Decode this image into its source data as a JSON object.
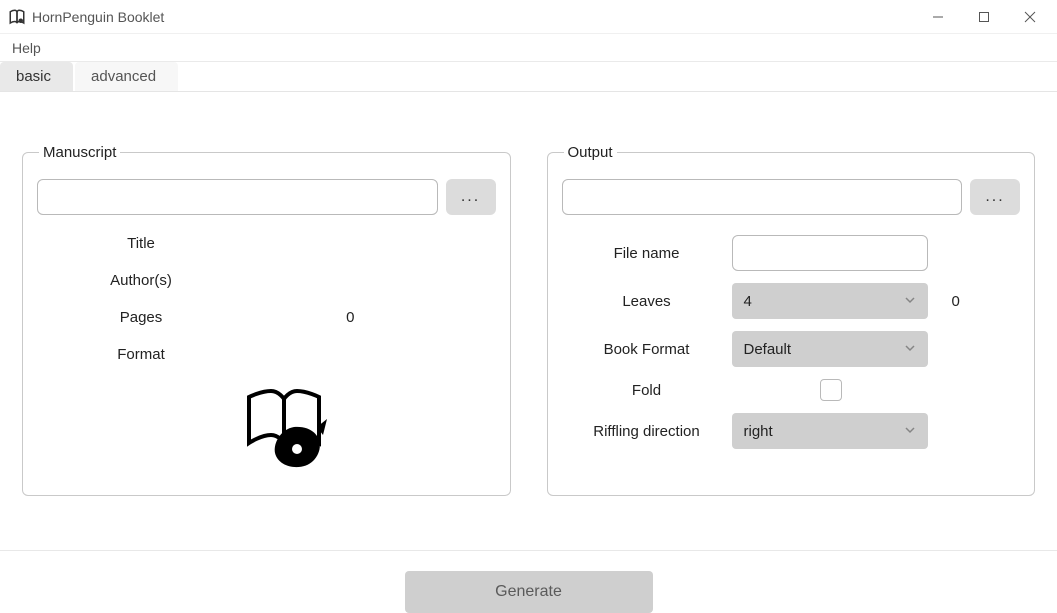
{
  "window": {
    "title": "HornPenguin Booklet"
  },
  "window_controls": {
    "minimize": "minimize",
    "maximize": "maximize",
    "close": "close"
  },
  "menu": {
    "help": "Help"
  },
  "tabs": {
    "basic": "basic",
    "advanced": "advanced",
    "active": "basic"
  },
  "sections": {
    "manuscript": {
      "legend": "Manuscript",
      "path": "",
      "browse": "...",
      "fields": {
        "title": {
          "label": "Title",
          "value": ""
        },
        "authors": {
          "label": "Author(s)",
          "value": ""
        },
        "pages": {
          "label": "Pages",
          "value": "0"
        },
        "format": {
          "label": "Format",
          "value": ""
        }
      }
    },
    "output": {
      "legend": "Output",
      "path": "",
      "browse": "...",
      "fields": {
        "file_name": {
          "label": "File name",
          "value": ""
        },
        "leaves": {
          "label": "Leaves",
          "selected": "4",
          "count": "0"
        },
        "book_format": {
          "label": "Book Format",
          "selected": "Default"
        },
        "fold": {
          "label": "Fold",
          "checked": false
        },
        "riffling": {
          "label": "Riffling direction",
          "selected": "right"
        }
      }
    }
  },
  "actions": {
    "generate": "Generate"
  }
}
